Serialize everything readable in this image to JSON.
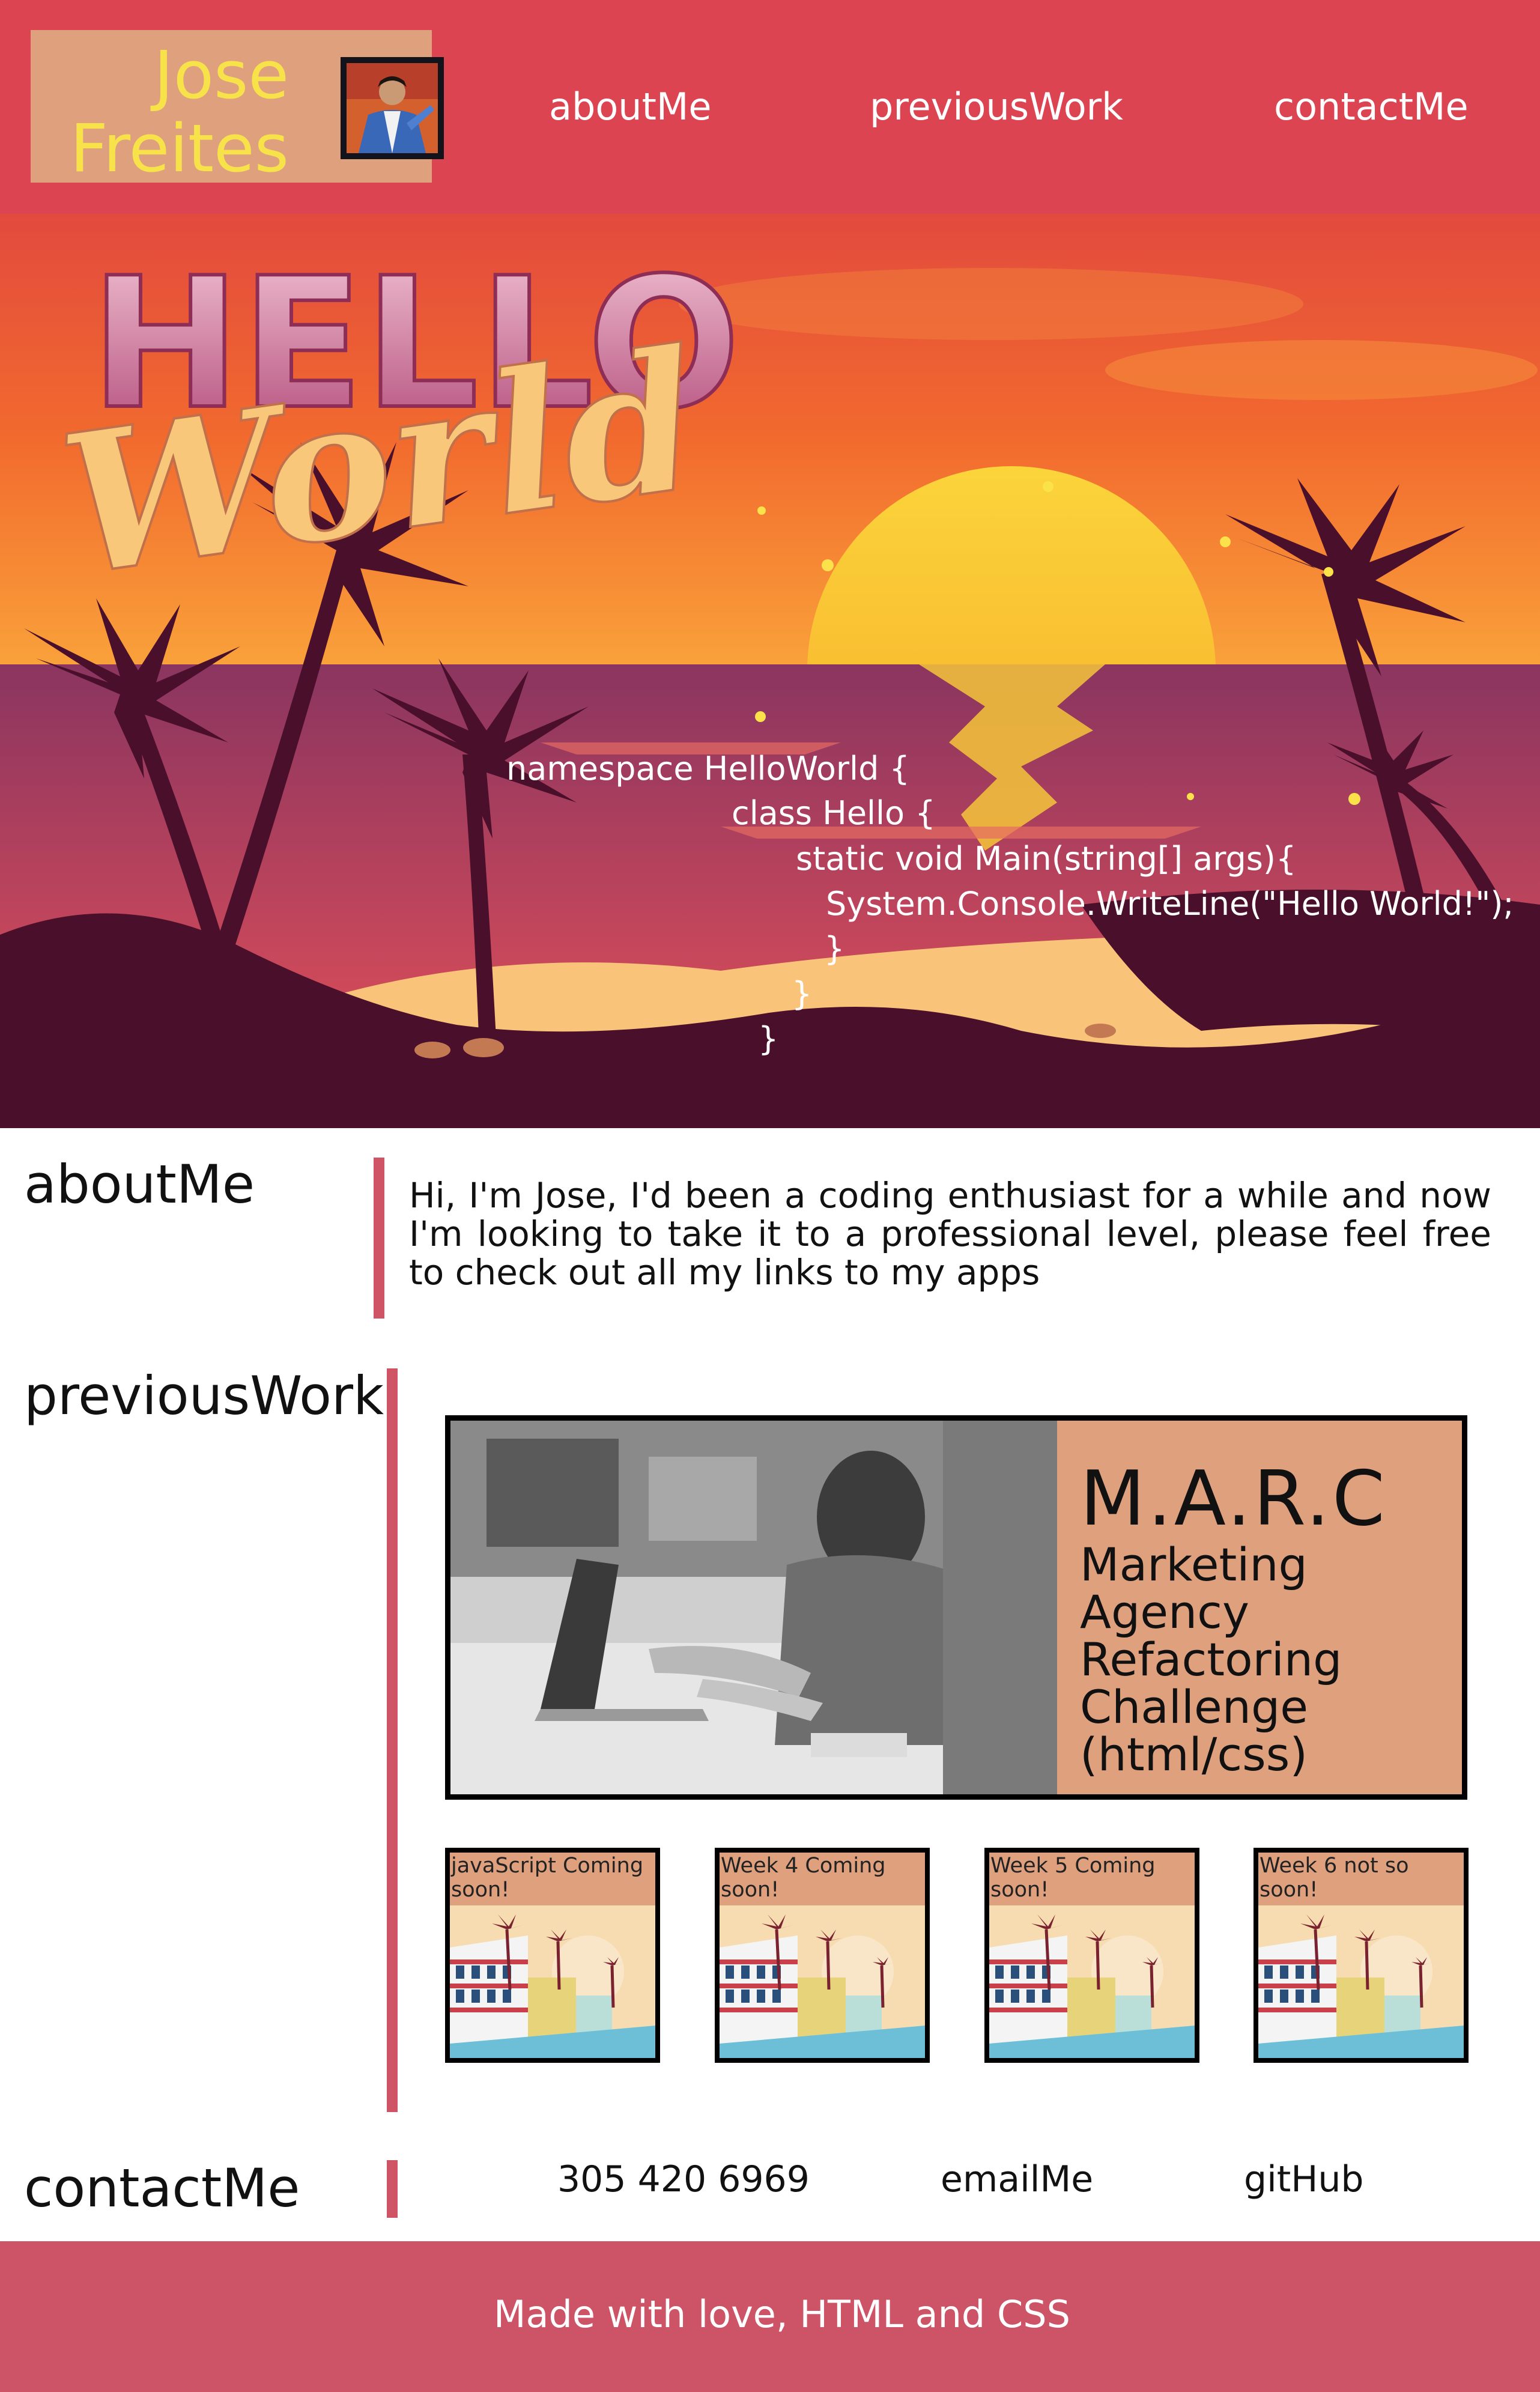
{
  "header": {
    "logo": {
      "name_line1": "Jose",
      "name_line2": "Freites"
    },
    "nav": [
      {
        "label": "aboutMe"
      },
      {
        "label": "previousWork"
      },
      {
        "label": "contactMe"
      }
    ]
  },
  "hero": {
    "title_word1": "HELLO",
    "title_word2": "World",
    "code_lines": [
      "namespace HelloWorld {",
      "class Hello {",
      "static void Main(string[] args){",
      "System.Console.WriteLine(\"Hello World!\");",
      "}",
      "}",
      "}"
    ]
  },
  "about": {
    "title": "aboutMe",
    "text": "Hi, I'm Jose, I'd been a coding enthusiast for a while and now I'm looking to take it to a professional level, please feel free to check out all my links to my apps"
  },
  "previous_work": {
    "title": "previousWork",
    "feature": {
      "title": "M.A.R.C",
      "lines": [
        "Marketing",
        "Agency",
        "Refactoring",
        "Challenge",
        "(html/css)"
      ]
    },
    "cards": [
      {
        "label": "javaScript Coming soon!"
      },
      {
        "label": "Week 4 Coming soon!"
      },
      {
        "label": "Week 5 Coming soon!"
      },
      {
        "label": "Week 6 not so soon!"
      }
    ]
  },
  "contact": {
    "title": "contactMe",
    "phone": "305 420 6969",
    "email_label": "emailMe",
    "github_label": "gitHub"
  },
  "footer": {
    "text": "Made with love, HTML and CSS"
  },
  "colors": {
    "header_bg": "#dd4452",
    "logo_bg": "#dfa07e",
    "logo_text": "#f7e24a",
    "accent_bar": "#cf5566",
    "panel_bg": "#dfa07e",
    "footer_bg": "#cd5466"
  }
}
